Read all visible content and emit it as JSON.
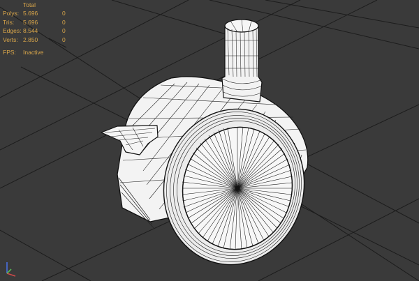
{
  "viewport": {
    "stats": {
      "header": "Total",
      "rows": [
        {
          "label": "Polys:",
          "total": "5.696",
          "selected": "0"
        },
        {
          "label": "Tris:",
          "total": "5.696",
          "selected": "0"
        },
        {
          "label": "Edges:",
          "total": "8.544",
          "selected": "0"
        },
        {
          "label": "Verts:",
          "total": "2.850",
          "selected": "0"
        }
      ],
      "fps_label": "FPS:",
      "fps_value": "Inactive"
    },
    "colors": {
      "background": "#3a3a3a",
      "grid": "#1e1e1e",
      "stats_text": "#d9a64a",
      "mesh_fill": "#f4f4f4",
      "wire": "#111111"
    },
    "icons": {
      "axis_gizmo": "xyz-axis-icon"
    }
  }
}
